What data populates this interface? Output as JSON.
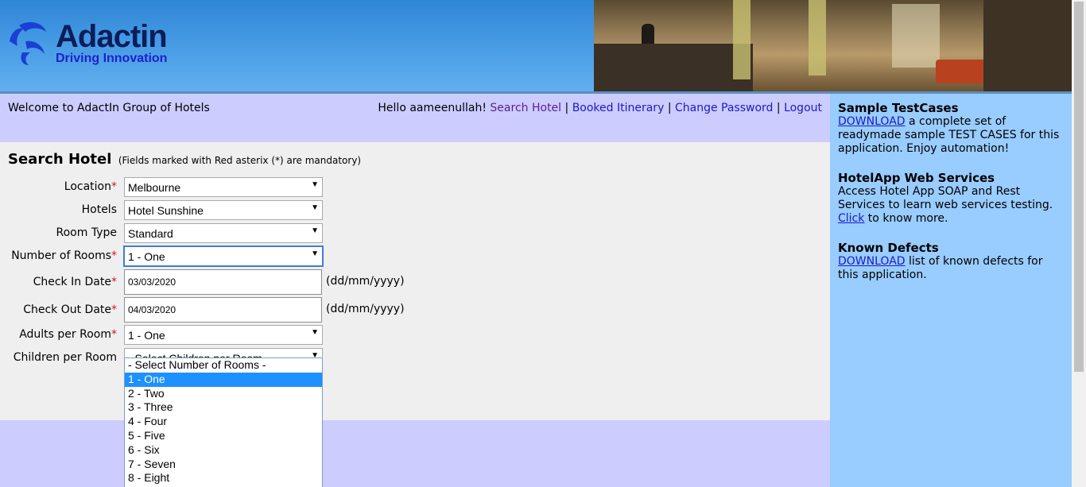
{
  "header": {
    "brand": "Adactin",
    "tagline": "Driving Innovation"
  },
  "welcome": {
    "text": "Welcome to AdactIn Group of Hotels",
    "greeting": "Hello aameenullah!",
    "nav": [
      "Search Hotel",
      "Booked Itinerary",
      "Change Password",
      "Logout"
    ],
    "separator": "|"
  },
  "search": {
    "title": "Search Hotel",
    "subtitle": "(Fields marked with Red asterix (*) are mandatory)",
    "required_mark": "*",
    "date_hint": "(dd/mm/yyyy)",
    "fields": {
      "location": {
        "label": "Location",
        "value": "Melbourne",
        "required": true
      },
      "hotels": {
        "label": "Hotels",
        "value": "Hotel Sunshine",
        "required": false
      },
      "room_type": {
        "label": "Room Type",
        "value": "Standard",
        "required": false
      },
      "num_rooms": {
        "label": "Number of Rooms",
        "value": "1 - One",
        "required": true
      },
      "check_in": {
        "label": "Check In Date",
        "value": "03/03/2020",
        "required": true
      },
      "check_out": {
        "label": "Check Out Date",
        "value": "04/03/2020",
        "required": true
      },
      "adults": {
        "label": "Adults per Room",
        "value": "1 - One",
        "required": true
      },
      "children": {
        "label": "Children per Room",
        "value": "- Select Children per Room -",
        "required": false
      }
    },
    "rooms_dropdown": {
      "options": [
        "- Select Number of Rooms -",
        "1 - One",
        "2 - Two",
        "3 - Three",
        "4 - Four",
        "5 - Five",
        "6 - Six",
        "7 - Seven",
        "8 - Eight"
      ],
      "selected_index": 1
    }
  },
  "sidebar": {
    "testcases": {
      "title": "Sample TestCases",
      "link": "DOWNLOAD",
      "text": " a complete set of readymade sample TEST CASES for this application. Enjoy automation!"
    },
    "webservices": {
      "title": "HotelApp Web Services",
      "text": "Access Hotel App SOAP and Rest Services to learn web services testing. ",
      "link": "Click",
      "text2": " to know more."
    },
    "defects": {
      "title": "Known Defects",
      "link": "DOWNLOAD",
      "text": " list of known defects for this application."
    }
  },
  "colors": {
    "header_blue": "#4a9ee6",
    "nav_bar": "#ccccff",
    "sidebar": "#99ccff",
    "required": "#e0101a",
    "selected_option": "#1e90ff"
  }
}
